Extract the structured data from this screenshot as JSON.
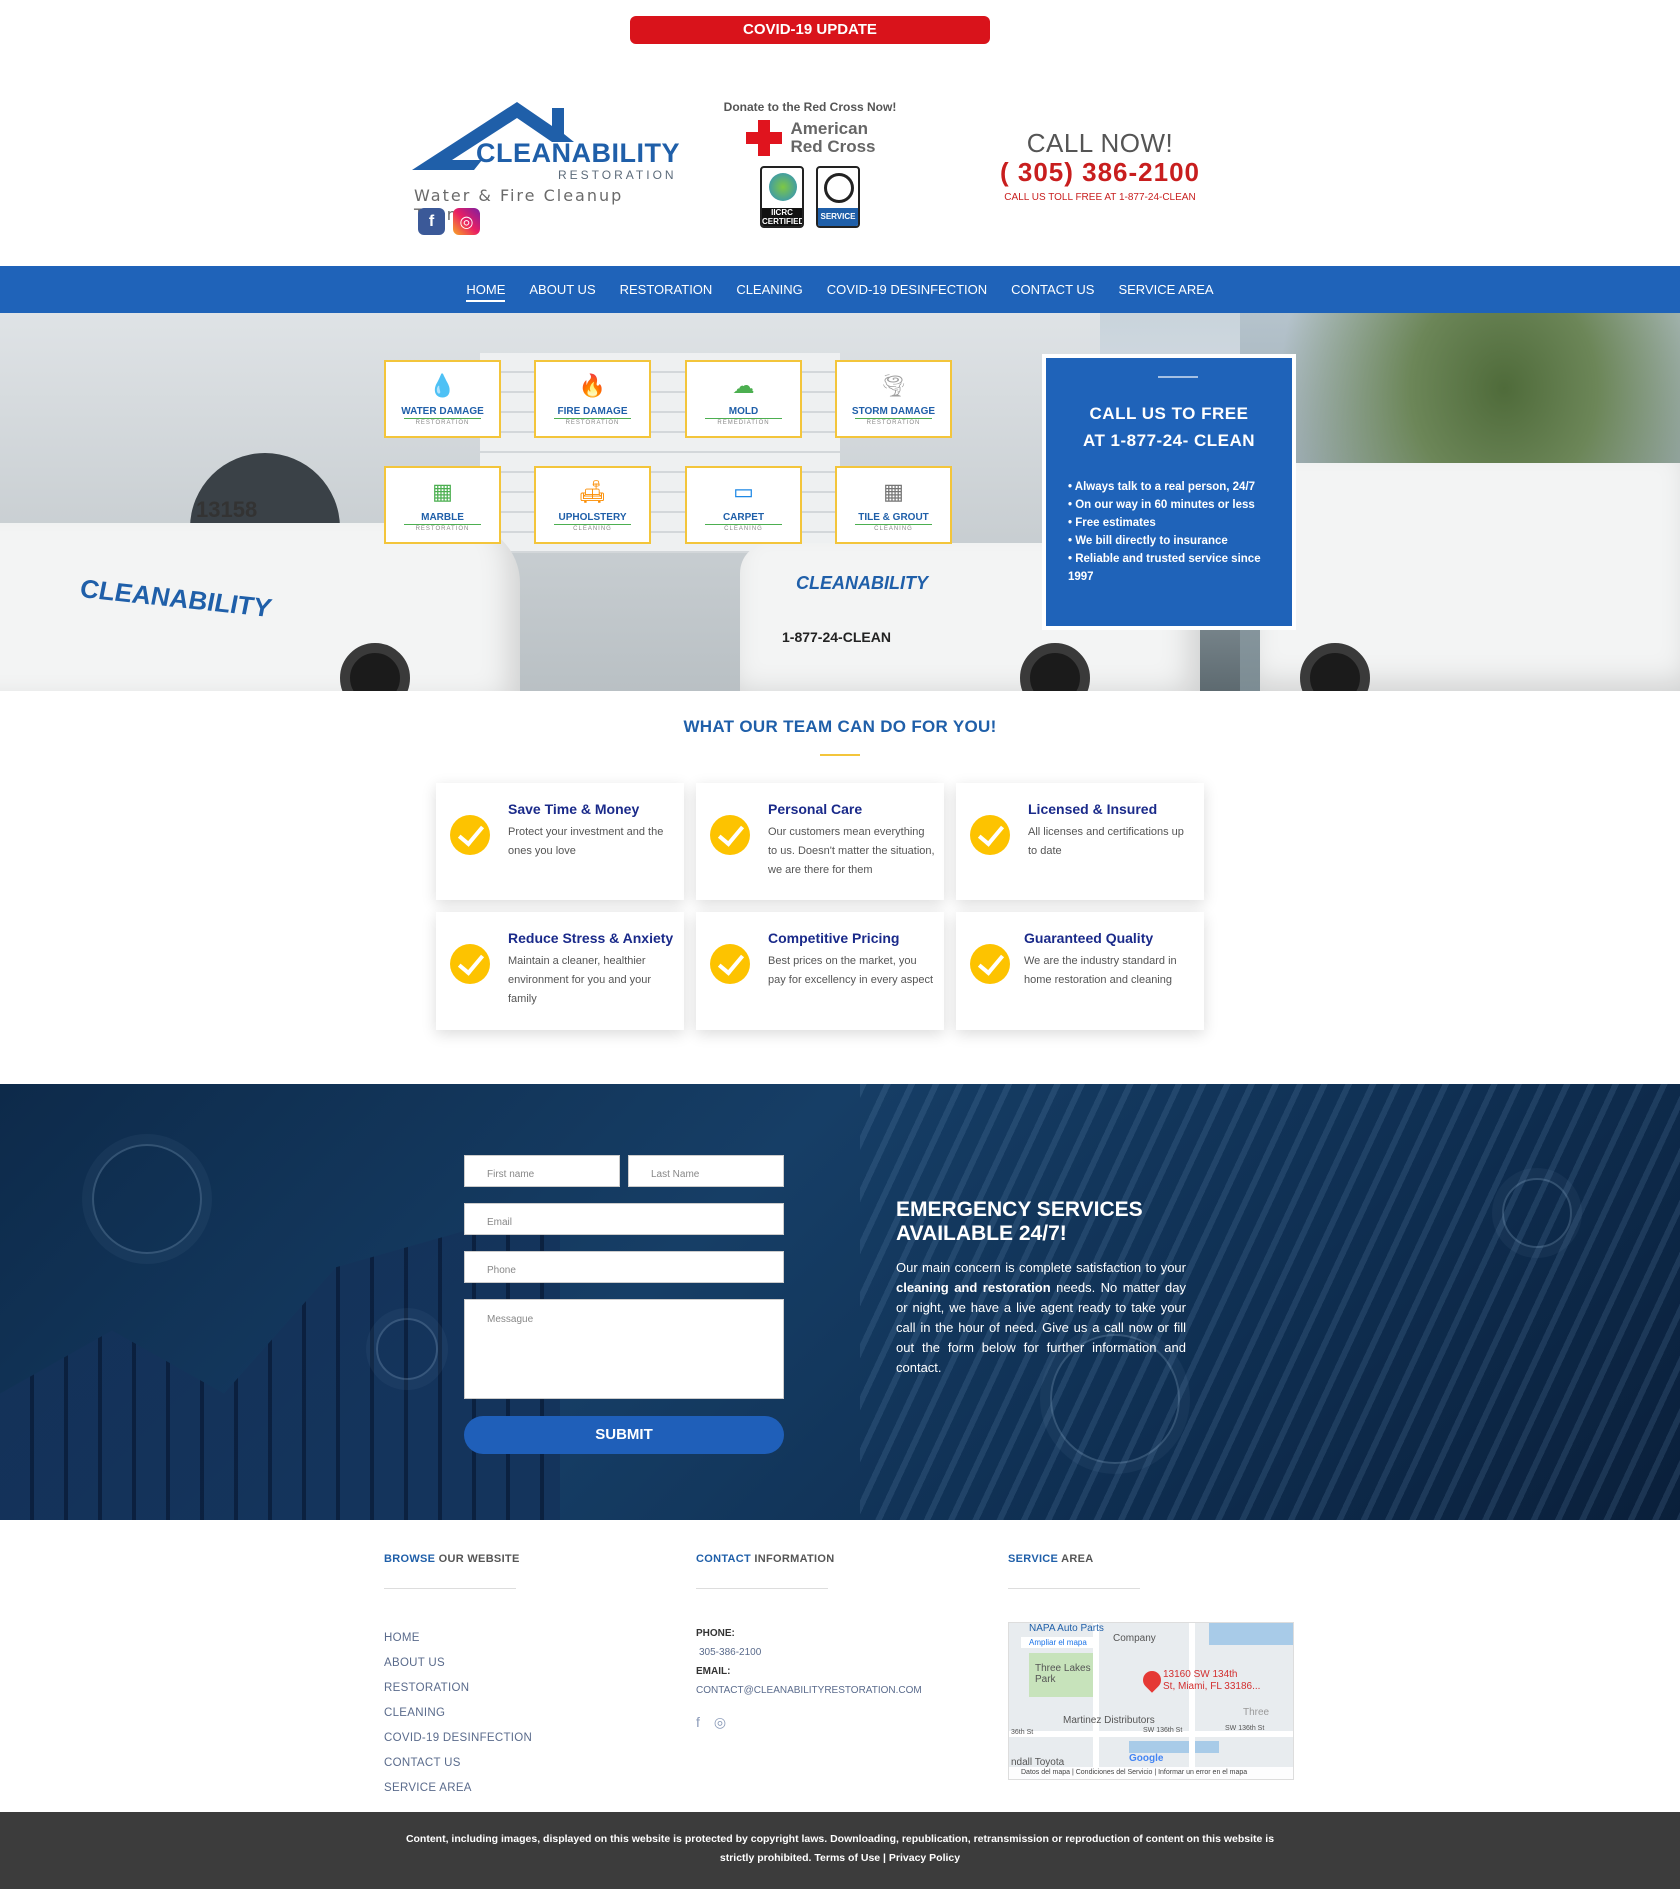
{
  "covid": {
    "label": "COVID-19 UPDATE"
  },
  "brand": {
    "name": "CLEANABILITY",
    "sub": "RESTORATION",
    "tagline": "Water & Fire Cleanup Team",
    "social": [
      "f",
      "◎"
    ]
  },
  "redcross": {
    "donate": "Donate to the Red Cross Now!",
    "org_line1": "American",
    "org_line2": "Red Cross",
    "badge1": "IICRC CERTIFIED",
    "badge2": "SERVICE"
  },
  "callnow": {
    "title": "CALL NOW!",
    "phone": "( 305) 386-2100",
    "tollfree": "CALL US TOLL FREE AT 1-877-24-CLEAN"
  },
  "nav": {
    "items": [
      "HOME",
      "ABOUT US",
      "RESTORATION",
      "CLEANING",
      "COVID-19 DESINFECTION",
      "CONTACT US",
      "SERVICE AREA"
    ],
    "active": "HOME"
  },
  "hero": {
    "building_number": "13158",
    "van_text": "1-877-24-CLEAN",
    "tiles": [
      {
        "label": "WATER DAMAGE",
        "sub": "RESTORATION",
        "icon": "💧",
        "color": "#1e88e5"
      },
      {
        "label": "FIRE DAMAGE",
        "sub": "RESTORATION",
        "icon": "🔥",
        "color": "#e53935"
      },
      {
        "label": "MOLD",
        "sub": "REMEDIATION",
        "icon": "☁",
        "color": "#4caf50"
      },
      {
        "label": "STORM DAMAGE",
        "sub": "RESTORATION",
        "icon": "🌪",
        "color": "#9e9e9e"
      },
      {
        "label": "MARBLE",
        "sub": "RESTORATION",
        "icon": "▦",
        "color": "#4caf50"
      },
      {
        "label": "UPHOLSTERY",
        "sub": "CLEANING",
        "icon": "🛋",
        "color": "#fb8c00"
      },
      {
        "label": "CARPET",
        "sub": "CLEANING",
        "icon": "▭",
        "color": "#1e88e5"
      },
      {
        "label": "TILE & GROUT",
        "sub": "CLEANING",
        "icon": "▦",
        "color": "#757575"
      }
    ],
    "callbox": {
      "line1": "CALL US TO FREE",
      "line2": "AT 1-877-24- CLEAN",
      "bullets": [
        "Always talk to a real person, 24/7",
        "On our way in 60 minutes or less",
        "Free estimates",
        "We bill directly to insurance",
        "Reliable and trusted service since 1997"
      ]
    }
  },
  "services": {
    "title": "WHAT OUR TEAM CAN DO FOR YOU!",
    "cards": [
      {
        "title": "Save Time & Money",
        "desc": "Protect your investment and the ones you love"
      },
      {
        "title": "Personal Care",
        "desc": "Our customers mean everything to us. Doesn't matter the situation, we are there for them"
      },
      {
        "title": "Licensed & Insured",
        "desc": "All licenses and certifications up to date"
      },
      {
        "title": "Reduce Stress & Anxiety",
        "desc": "Maintain a cleaner, healthier environment for you and your family"
      },
      {
        "title": "Competitive Pricing",
        "desc": "Best prices on the market, you pay for excellency in every aspect"
      },
      {
        "title": "Guaranteed Quality",
        "desc": "We are the industry standard in home restoration and cleaning"
      }
    ]
  },
  "form": {
    "first_name": "First name",
    "last_name": "Last Name",
    "email": "Email",
    "phone": "Phone",
    "message": "Messague",
    "submit": "SUBMIT"
  },
  "emergency": {
    "title": "EMERGENCY SERVICES AVAILABLE 24/7!",
    "p1": "Our main concern is complete satisfaction to your ",
    "bold": "cleaning and restoration",
    "p2": " needs. No matter day or night, we have a live agent ready to take your call in the hour of need. Give us a call now or fill out the form below for further information and contact."
  },
  "footer": {
    "browse_hl": "BROWSE",
    "browse_rest": " OUR WEBSITE",
    "contact_hl": "CONTACT",
    "contact_rest": " INFORMATION",
    "area_hl": "SERVICE",
    "area_rest": " AREA",
    "links": [
      "HOME",
      "ABOUT US",
      "RESTORATION",
      "CLEANING",
      "COVID-19 DESINFECTION",
      "CONTACT US",
      "SERVICE AREA"
    ],
    "phone_label": "PHONE:",
    "phone": "305-386-2100",
    "email_label": "EMAIL:",
    "email": "CONTACT@CLEANABILITYRESTORATION.COM",
    "map": {
      "enlarge": "Ampliar el mapa",
      "napa": "NAPA Auto Parts",
      "company": "Company",
      "park": "Three Lakes Park",
      "address1": "13160 SW 134th",
      "address2": "St, Miami, FL 33186...",
      "distributor": "Martinez Distributors",
      "street1": "SW 136th St",
      "street2": "SW 136th St",
      "street3": "36th St",
      "three": "Three",
      "toyota": "ndall Toyota",
      "google": "Google",
      "footer": "Datos del mapa | Condiciones del Servicio | Informar un error en el mapa"
    }
  },
  "copyright": {
    "line1": "Content, including images, displayed on this website is protected by copyright laws. Downloading, republication, retransmission or reproduction of content on this website is",
    "line2": "strictly prohibited. Terms of Use | Privacy Policy"
  }
}
